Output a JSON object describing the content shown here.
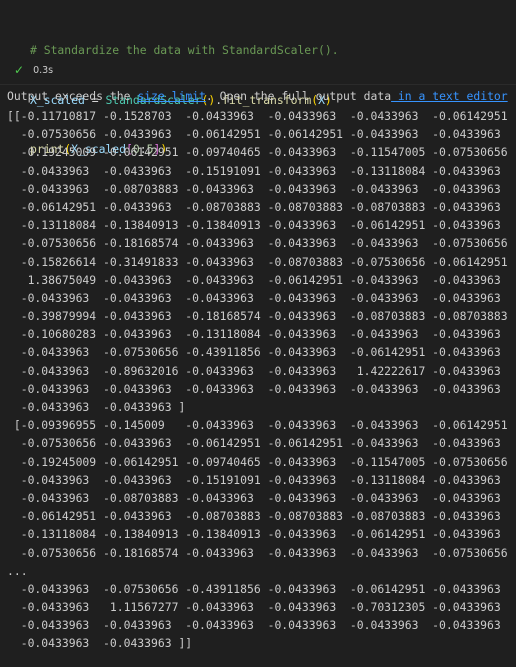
{
  "code": {
    "comment": "# Standardize the data with StandardScaler().",
    "line2": {
      "var": "X_scaled",
      "eq": " = ",
      "cls": "StandardScaler",
      "call_open": "()",
      "dot": ".",
      "method": "fit_transform",
      "paren_open": "(",
      "arg": "X",
      "paren_close": ")"
    },
    "line3": {
      "fn": "print",
      "paren_open": "(",
      "var": "X_scaled",
      "bracket_open": "[",
      "start": "0",
      "colon": ":",
      "end": "5",
      "bracket_close": "]",
      "paren_close": ")"
    }
  },
  "status": {
    "icon": "check-icon",
    "time": "0.3s"
  },
  "output": {
    "notice_prefix": "Output exceeds the ",
    "size_link": "size limit",
    "notice_middle": ". Open the full output data",
    "editor_link": " in a text editor",
    "lines": [
      "[[-0.11710817 -0.1528703  -0.0433963  -0.0433963  -0.0433963  -0.06142951",
      "  -0.07530656 -0.0433963  -0.06142951 -0.06142951 -0.0433963  -0.0433963",
      "  -0.19245009 -0.06142951 -0.09740465 -0.0433963  -0.11547005 -0.07530656",
      "  -0.0433963  -0.0433963  -0.15191091 -0.0433963  -0.13118084 -0.0433963",
      "  -0.0433963  -0.08703883 -0.0433963  -0.0433963  -0.0433963  -0.0433963",
      "  -0.06142951 -0.0433963  -0.08703883 -0.08703883 -0.08703883 -0.0433963",
      "  -0.13118084 -0.13840913 -0.13840913 -0.0433963  -0.06142951 -0.0433963",
      "  -0.07530656 -0.18168574 -0.0433963  -0.0433963  -0.0433963  -0.07530656",
      "  -0.15826614 -0.31491833 -0.0433963  -0.08703883 -0.07530656 -0.06142951",
      "   1.38675049 -0.0433963  -0.0433963  -0.06142951 -0.0433963  -0.0433963",
      "  -0.0433963  -0.0433963  -0.0433963  -0.0433963  -0.0433963  -0.0433963",
      "  -0.39879994 -0.0433963  -0.18168574 -0.0433963  -0.08703883 -0.08703883",
      "  -0.10680283 -0.0433963  -0.13118084 -0.0433963  -0.0433963  -0.0433963",
      "  -0.0433963  -0.07530656 -0.43911856 -0.0433963  -0.06142951 -0.0433963",
      "  -0.0433963  -0.89632016 -0.0433963  -0.0433963   1.42222617 -0.0433963",
      "  -0.0433963  -0.0433963  -0.0433963  -0.0433963  -0.0433963  -0.0433963",
      "  -0.0433963  -0.0433963 ]",
      " [-0.09396955 -0.145009   -0.0433963  -0.0433963  -0.0433963  -0.06142951",
      "  -0.07530656 -0.0433963  -0.06142951 -0.06142951 -0.0433963  -0.0433963",
      "  -0.19245009 -0.06142951 -0.09740465 -0.0433963  -0.11547005 -0.07530656",
      "  -0.0433963  -0.0433963  -0.15191091 -0.0433963  -0.13118084 -0.0433963",
      "  -0.0433963  -0.08703883 -0.0433963  -0.0433963  -0.0433963  -0.0433963",
      "  -0.06142951 -0.0433963  -0.08703883 -0.08703883 -0.08703883 -0.0433963",
      "  -0.13118084 -0.13840913 -0.13840913 -0.0433963  -0.06142951 -0.0433963",
      "  -0.07530656 -0.18168574 -0.0433963  -0.0433963  -0.0433963  -0.07530656",
      "...",
      "  -0.0433963  -0.07530656 -0.43911856 -0.0433963  -0.06142951 -0.0433963",
      "  -0.0433963   1.11567277 -0.0433963  -0.0433963  -0.70312305 -0.0433963",
      "  -0.0433963  -0.0433963  -0.0433963  -0.0433963  -0.0433963  -0.0433963",
      "  -0.0433963  -0.0433963 ]]"
    ]
  }
}
